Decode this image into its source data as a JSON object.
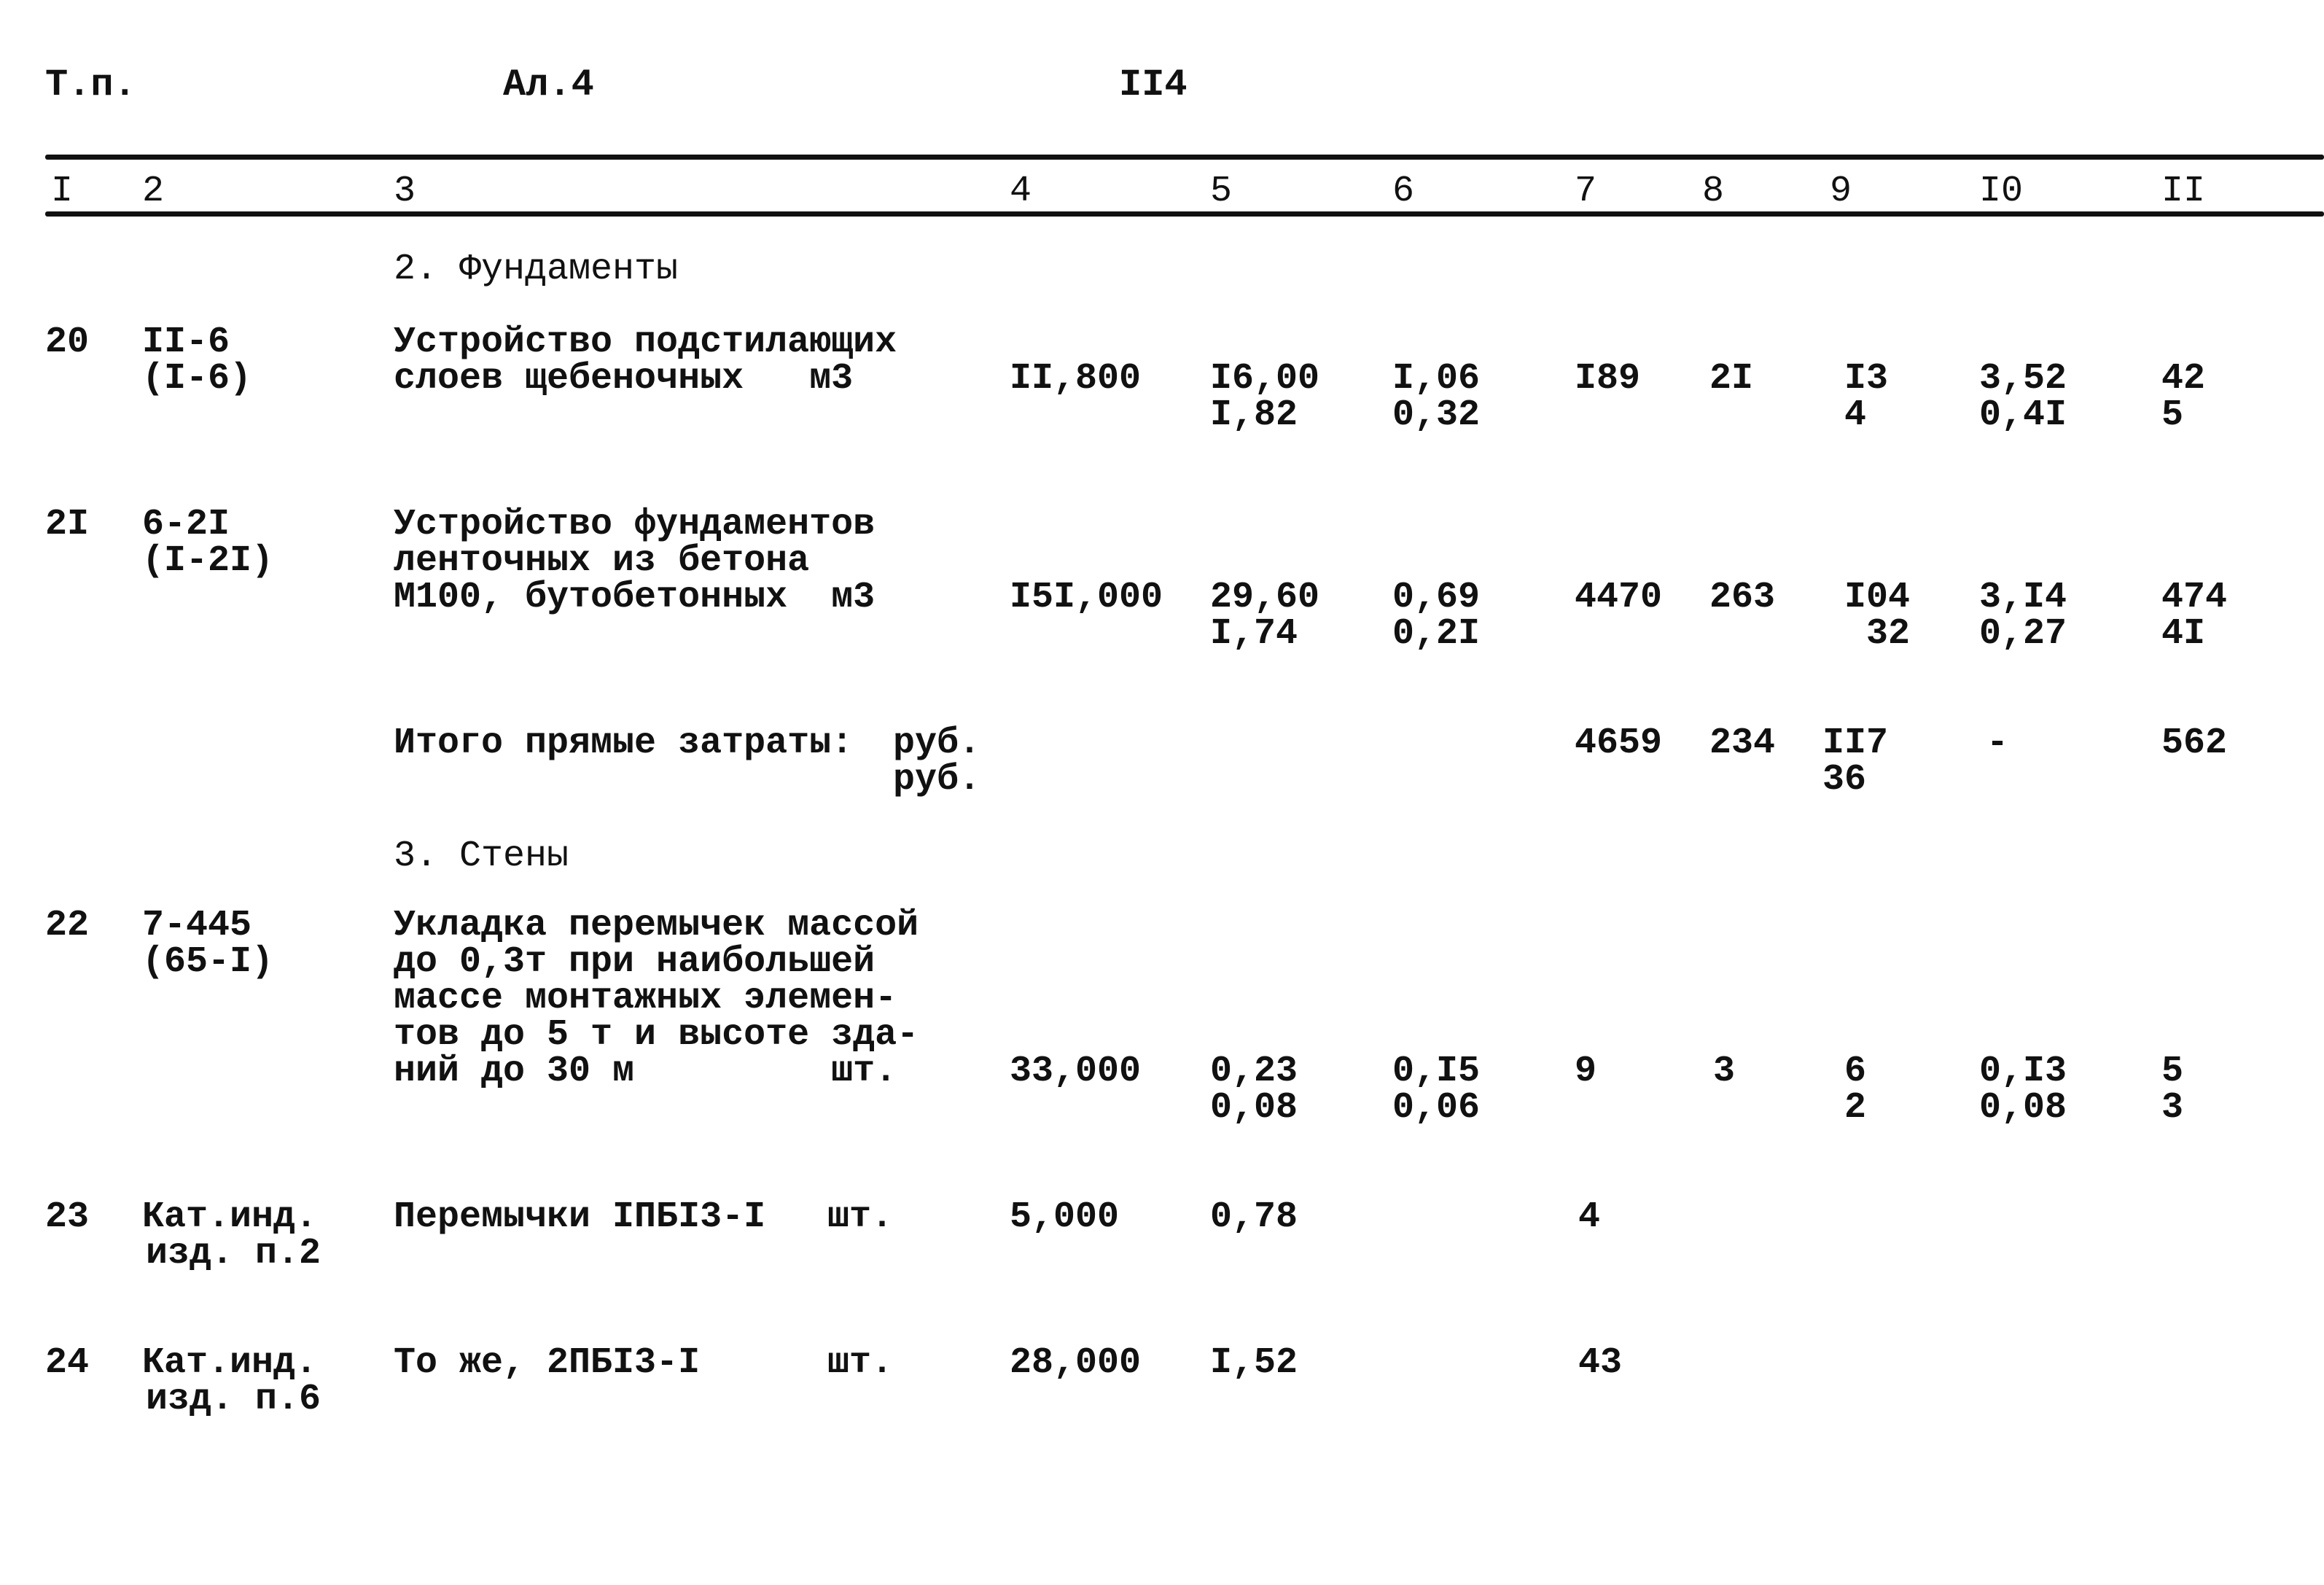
{
  "header": {
    "left": "Т.п.",
    "middle": "Ал.4",
    "page_number": "II4"
  },
  "columns": [
    "I",
    "2",
    "3",
    "4",
    "5",
    "6",
    "7",
    "8",
    "9",
    "I0",
    "II"
  ],
  "sections": {
    "foundations": "2. Фундаменты",
    "walls": "3. Стены"
  },
  "rows": [
    {
      "no": "20",
      "code": [
        "II-6",
        "(I-6)"
      ],
      "description": [
        "Устройство подстилающих",
        "слоев щебеночных"
      ],
      "unit": "м3",
      "qty": "II,800",
      "c5": [
        "I6,00",
        "I,82"
      ],
      "c6": [
        "I,06",
        "0,32"
      ],
      "c7": "I89",
      "c8": "2I",
      "c9": [
        "I3",
        "4"
      ],
      "c10": [
        "3,52",
        "0,4I"
      ],
      "c11": [
        "42",
        "5"
      ]
    },
    {
      "no": "2I",
      "code": [
        "6-2I",
        "(I-2I)"
      ],
      "description": [
        "Устройство фундаментов",
        "ленточных из бетона",
        "М100, бутобетонных"
      ],
      "unit": "м3",
      "qty": "I5I,000",
      "c5": [
        "29,60",
        "I,74"
      ],
      "c6": [
        "0,69",
        "0,2I"
      ],
      "c7": "4470",
      "c8": "263",
      "c9": [
        "I04",
        "32"
      ],
      "c10": [
        "3,I4",
        "0,27"
      ],
      "c11": [
        "474",
        "4I"
      ]
    },
    {
      "no": "22",
      "code": [
        "7-445",
        "(65-I)"
      ],
      "description": [
        "Укладка перемычек массой",
        "до 0,3т при наибольшей",
        "массе монтажных элемен-",
        "тов до 5 т и высоте зда-",
        "ний до 30 м"
      ],
      "unit": "шт.",
      "qty": "33,000",
      "c5": [
        "0,23",
        "0,08"
      ],
      "c6": [
        "0,I5",
        "0,06"
      ],
      "c7": "9",
      "c8": "3",
      "c9": [
        "6",
        "2"
      ],
      "c10": [
        "0,I3",
        "0,08"
      ],
      "c11": [
        "5",
        "3"
      ]
    },
    {
      "no": "23",
      "code": [
        "Кат.инд.",
        "изд. п.2"
      ],
      "description": [
        "Перемычки IПБI3-I"
      ],
      "unit": "шт.",
      "qty": "5,000",
      "c5": [
        "0,78"
      ],
      "c7": "4"
    },
    {
      "no": "24",
      "code": [
        "Кат.инд.",
        "изд. п.6"
      ],
      "description": [
        "То же, 2ПБI3-I"
      ],
      "unit": "шт.",
      "qty": "28,000",
      "c5": [
        "I,52"
      ],
      "c7": "43"
    }
  ],
  "totals": {
    "label": "Итого прямые затраты:",
    "units": [
      "руб.",
      "руб."
    ],
    "c7": "4659",
    "c8": "234",
    "c9": [
      "II7",
      "36"
    ],
    "c10": "-",
    "c11": "562"
  }
}
